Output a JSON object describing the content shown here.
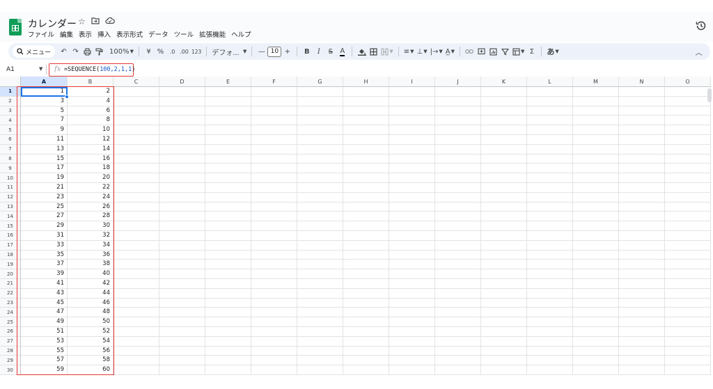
{
  "document": {
    "title": "カレンダー"
  },
  "menu": [
    "ファイル",
    "編集",
    "表示",
    "挿入",
    "表示形式",
    "データ",
    "ツール",
    "拡張機能",
    "ヘルプ"
  ],
  "toolbar": {
    "search_label": "メニュー",
    "zoom": "100%",
    "currency": "¥",
    "percent": "%",
    "decimal_decrease": ".0",
    "decimal_increase": ".00",
    "number_format": "123",
    "font_name": "デフォ...",
    "font_size": "10",
    "sum": "Σ",
    "input_tool": "あ"
  },
  "formula_bar": {
    "name_box": "A1",
    "fx": "fx",
    "formula_prefix": "=SEQUENCE(",
    "formula_args": "100,2,1,1",
    "formula_suffix": ")"
  },
  "columns": [
    "A",
    "B",
    "C",
    "D",
    "E",
    "F",
    "G",
    "H",
    "I",
    "J",
    "K",
    "L",
    "M",
    "N",
    "O"
  ],
  "rows": [
    [
      "1",
      "2"
    ],
    [
      "3",
      "4"
    ],
    [
      "5",
      "6"
    ],
    [
      "7",
      "8"
    ],
    [
      "9",
      "10"
    ],
    [
      "11",
      "12"
    ],
    [
      "13",
      "14"
    ],
    [
      "15",
      "16"
    ],
    [
      "17",
      "18"
    ],
    [
      "19",
      "20"
    ],
    [
      "21",
      "22"
    ],
    [
      "23",
      "24"
    ],
    [
      "25",
      "26"
    ],
    [
      "27",
      "28"
    ],
    [
      "29",
      "30"
    ],
    [
      "31",
      "32"
    ],
    [
      "33",
      "34"
    ],
    [
      "35",
      "36"
    ],
    [
      "37",
      "38"
    ],
    [
      "39",
      "40"
    ],
    [
      "41",
      "42"
    ],
    [
      "43",
      "44"
    ],
    [
      "45",
      "46"
    ],
    [
      "47",
      "48"
    ],
    [
      "49",
      "50"
    ],
    [
      "51",
      "52"
    ],
    [
      "53",
      "54"
    ],
    [
      "55",
      "56"
    ],
    [
      "57",
      "58"
    ],
    [
      "59",
      "60"
    ]
  ],
  "row_numbers": [
    "1",
    "2",
    "3",
    "4",
    "5",
    "6",
    "7",
    "8",
    "9",
    "10",
    "11",
    "12",
    "13",
    "14",
    "15",
    "16",
    "17",
    "18",
    "19",
    "20",
    "21",
    "22",
    "23",
    "24",
    "25",
    "26",
    "27",
    "28",
    "29",
    "30"
  ],
  "colors": {
    "sheets_green": "#0f9d58",
    "selection_blue": "#1a73e8",
    "highlight_red": "#e53935",
    "toolbar_bg": "#edf2fa"
  }
}
